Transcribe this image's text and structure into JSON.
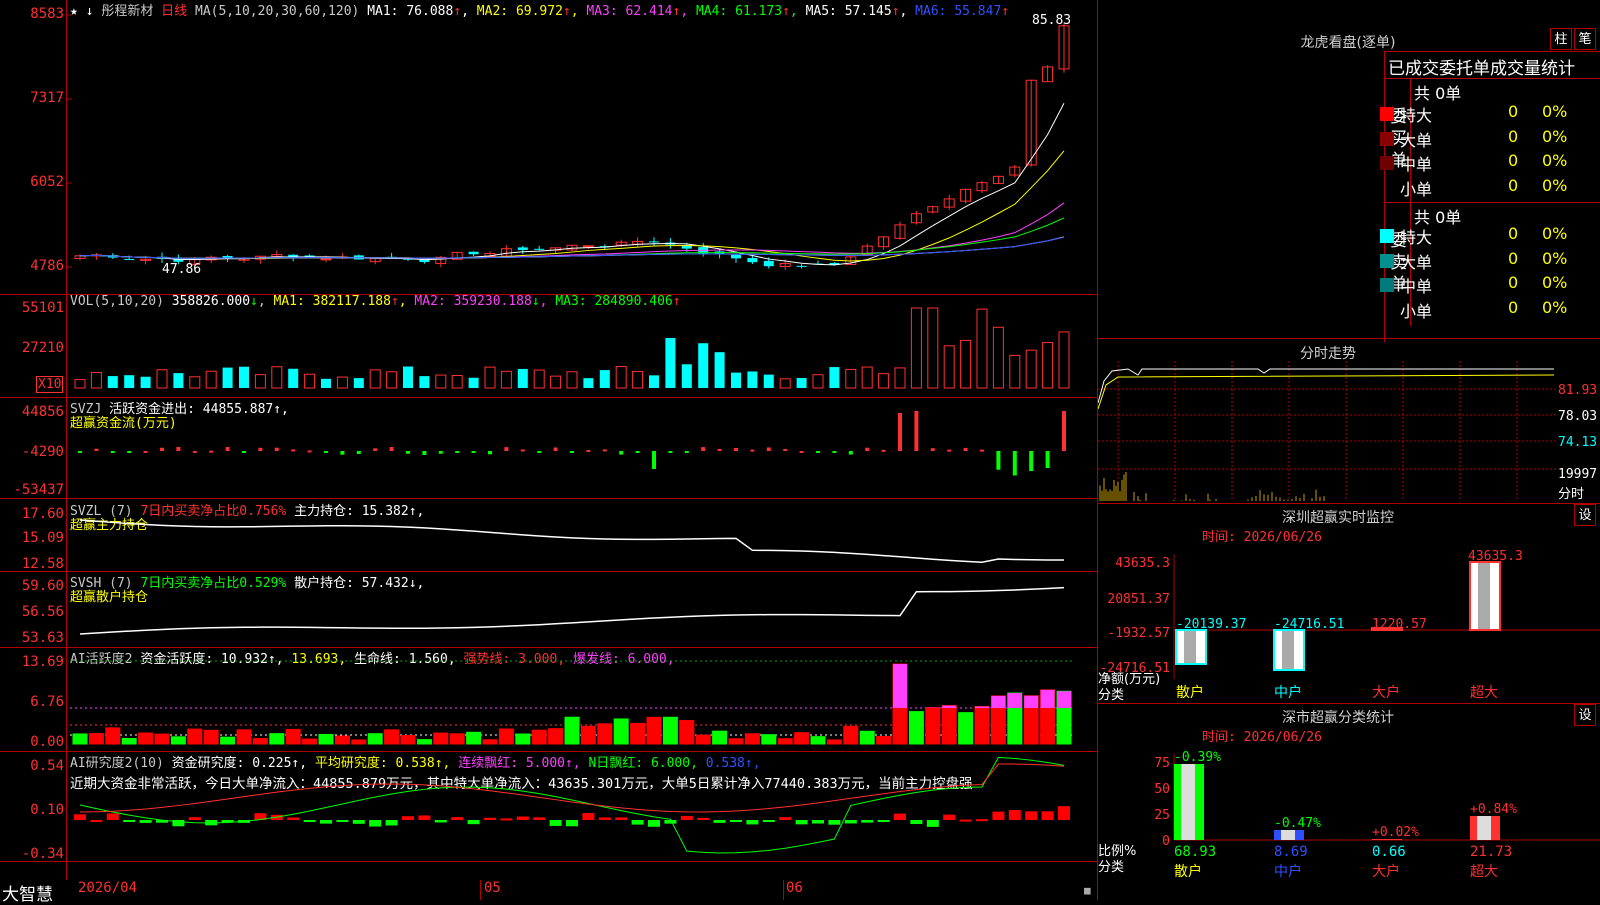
{
  "header": {
    "star": "★",
    "name": "彤程新材",
    "period": "日线",
    "ma_params": "MA(5,10,20,30,60,120)",
    "ma": [
      {
        "label": "MA1:",
        "value": "76.088",
        "arrow": "↑",
        "color": "#ffffff"
      },
      {
        "label": "MA2:",
        "value": "69.972",
        "arrow": "↑",
        "color": "#ffff00"
      },
      {
        "label": "MA3:",
        "value": "62.414",
        "arrow": "↑",
        "color": "#ff40ff"
      },
      {
        "label": "MA4:",
        "value": "61.173",
        "arrow": "↑",
        "color": "#00ff00"
      },
      {
        "label": "MA5:",
        "value": "57.145",
        "arrow": "↑",
        "color": "#ffffff"
      },
      {
        "label": "MA6:",
        "value": "55.847",
        "arrow": "↑",
        "color": "#3050ff"
      }
    ],
    "high_label": "85.83",
    "low_label": "47.86"
  },
  "price_axis": [
    "8583",
    "7317",
    "6052",
    "4786"
  ],
  "volume": {
    "title": "VOL(5,10,20)",
    "value": "358826.000",
    "value_arrow": "↓",
    "ma": [
      {
        "label": "MA1:",
        "value": "382117.188",
        "arrow": "↑",
        "color": "#ffff00"
      },
      {
        "label": "MA2:",
        "value": "359230.188",
        "arrow": "↓",
        "color": "#ff40ff"
      },
      {
        "label": "MA3:",
        "value": "284890.406",
        "arrow": "↑",
        "color": "#00ff00"
      }
    ],
    "axis": [
      "55101",
      "27210"
    ],
    "unit": "X10"
  },
  "svzj": {
    "title": "SVZJ",
    "line1": "活跃资金进出: 44855.887↑,",
    "line2": "超赢资金流(万元)",
    "axis": [
      "44856",
      "-4290",
      "-53437"
    ]
  },
  "svzl": {
    "title": "SVZL (7)",
    "pct": "7日内买卖净占比0.756%",
    "hold": "主力持仓: 15.382↑,",
    "line2": "超赢主力持仓",
    "axis": [
      "17.60",
      "15.09",
      "12.58"
    ]
  },
  "svsh": {
    "title": "SVSH (7)",
    "pct": "7日内买卖净占比0.529%",
    "hold": "散户持仓: 57.432↓,",
    "line2": "超赢散户持仓",
    "axis": [
      "59.60",
      "56.56",
      "53.63"
    ]
  },
  "ai_active": {
    "title": "AI活跃度2",
    "a": "资金活跃度: 10.932↑,",
    "b": "13.693,",
    "c": "生命线: 1.560,",
    "d": "强势线: 3.000,",
    "e": "爆发线: 6.000,",
    "axis": [
      "13.69",
      "6.76",
      "0.00"
    ]
  },
  "ai_research": {
    "title": "AI研究度2(10)",
    "a": "资金研究度: 0.225↑,",
    "b": "平均研究度: 0.538↑,",
    "c": "连续飘红: 5.000↑,",
    "d": "N日飘红: 6.000,",
    "e": "0.538↑,",
    "note": "近期大资金非常活跃，今日大单净流入：44855.879万元，其中特大单净流入：43635.301万元，大单5日累计净入77440.383万元，当前主力控盘强",
    "axis": [
      "0.54",
      "0.10",
      "-0.34"
    ]
  },
  "date_axis": {
    "start": "2026/04",
    "m05": "05",
    "m06": "06"
  },
  "brand": "大智慧",
  "lhb": {
    "title": "龙虎看盘(逐单)",
    "btn1": "柱",
    "btn2": "笔",
    "subtitle": "已成交委托单成交量统计",
    "buy_total": "共 0单",
    "buy_label": "委买单",
    "sell_total": "共 0单",
    "sell_label": "委卖单",
    "buy_rows": [
      {
        "name": "特大",
        "count": "0",
        "pct": "0%",
        "color": "#ff0000"
      },
      {
        "name": "大单",
        "count": "0",
        "pct": "0%",
        "color": "#8b0000"
      },
      {
        "name": "中单",
        "count": "0",
        "pct": "0%",
        "color": "#700000"
      },
      {
        "name": "小单",
        "count": "0",
        "pct": "0%",
        "color": ""
      }
    ],
    "sell_rows": [
      {
        "name": "特大",
        "count": "0",
        "pct": "0%",
        "color": "#00ffff"
      },
      {
        "name": "大单",
        "count": "0",
        "pct": "0%",
        "color": "#009090"
      },
      {
        "name": "中单",
        "count": "0",
        "pct": "0%",
        "color": "#007a7a"
      },
      {
        "name": "小单",
        "count": "0",
        "pct": "0%",
        "color": ""
      }
    ]
  },
  "fenshi": {
    "title": "分时走势",
    "axis": [
      "81.93",
      "78.03",
      "74.13"
    ],
    "vol": "19997",
    "vol_label": "分时"
  },
  "sz_monitor": {
    "title": "深圳超赢实时监控",
    "btn": "设",
    "time": "时间: 2026/06/26",
    "axis": [
      "43635.3",
      "20851.37",
      "-1932.57",
      "-24716.51"
    ],
    "bars": [
      {
        "name": "散户",
        "value": "-20139.37"
      },
      {
        "name": "中户",
        "value": "-24716.51"
      },
      {
        "name": "大户",
        "value": "1220.57"
      },
      {
        "name": "超大",
        "value": "43635.3"
      }
    ],
    "ylabel": "净额(万元)",
    "xlabel": "分类"
  },
  "sz_class": {
    "title": "深市超赢分类统计",
    "btn": "设",
    "time": "时间: 2026/06/26",
    "axis": [
      "75",
      "50",
      "25",
      "0"
    ],
    "bars": [
      {
        "name": "散户",
        "pct": "-0.39%",
        "value": "68.93"
      },
      {
        "name": "中户",
        "pct": "-0.47%",
        "value": "8.69"
      },
      {
        "name": "大户",
        "pct": "+0.02%",
        "value": "0.66"
      },
      {
        "name": "超大",
        "pct": "+0.84%",
        "value": "21.73"
      }
    ],
    "ylabel": "比例%",
    "xlabel": "分类"
  }
}
